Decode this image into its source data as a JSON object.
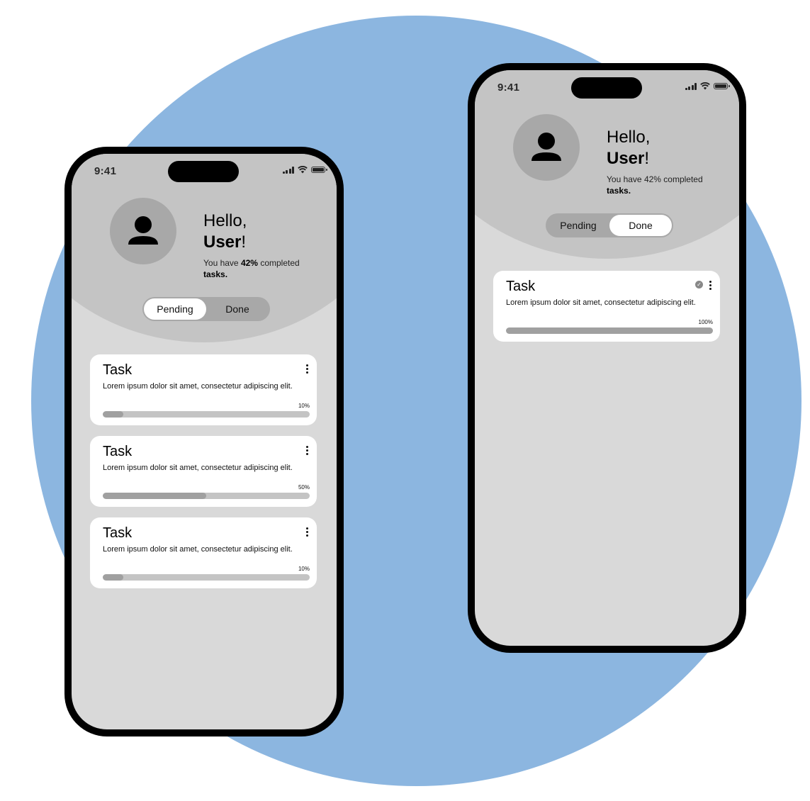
{
  "left_phone": {
    "status": {
      "time": "9:41"
    },
    "greeting": {
      "hello": "Hello,",
      "user_name": "User",
      "exclaim": "!",
      "summary_prefix": "You have ",
      "summary_percent": "42%",
      "summary_mid": " completed",
      "summary_tasks": "tasks."
    },
    "tabs": {
      "pending": "Pending",
      "done": "Done",
      "active": "pending"
    },
    "tasks": [
      {
        "title": "Task",
        "description": "Lorem ipsum dolor sit amet, consectetur adipiscing elit.",
        "progress_label": "10%",
        "progress": 0.1
      },
      {
        "title": "Task",
        "description": "Lorem ipsum dolor sit amet, consectetur adipiscing elit.",
        "progress_label": "50%",
        "progress": 0.5
      },
      {
        "title": "Task",
        "description": "Lorem ipsum dolor sit amet, consectetur adipiscing elit.",
        "progress_label": "10%",
        "progress": 0.1
      }
    ]
  },
  "right_phone": {
    "status": {
      "time": "9:41"
    },
    "greeting": {
      "hello": "Hello,",
      "user_name": "User",
      "exclaim": "!",
      "summary_prefix": "You have 42% completed",
      "summary_tasks": "tasks."
    },
    "tabs": {
      "pending": "Pending",
      "done": "Done",
      "active": "done"
    },
    "tasks": [
      {
        "title": "Task",
        "description": "Lorem ipsum dolor sit amet, consectetur adipiscing elit.",
        "progress_label": "100%",
        "progress": 1.0,
        "completed": true
      }
    ]
  },
  "icons": {
    "avatar": "user-avatar-icon",
    "menu": "kebab-menu-icon",
    "check": "check-circle-icon",
    "signal": "cellular-signal-icon",
    "wifi": "wifi-icon",
    "battery": "battery-icon"
  },
  "colors": {
    "background_circle": "#8cb6e0",
    "screen": "#d9d9d9",
    "header": "#c4c4c4",
    "avatar": "#a8a8a8",
    "progress_fill": "#a0a0a0",
    "progress_track": "#c4c4c4"
  }
}
